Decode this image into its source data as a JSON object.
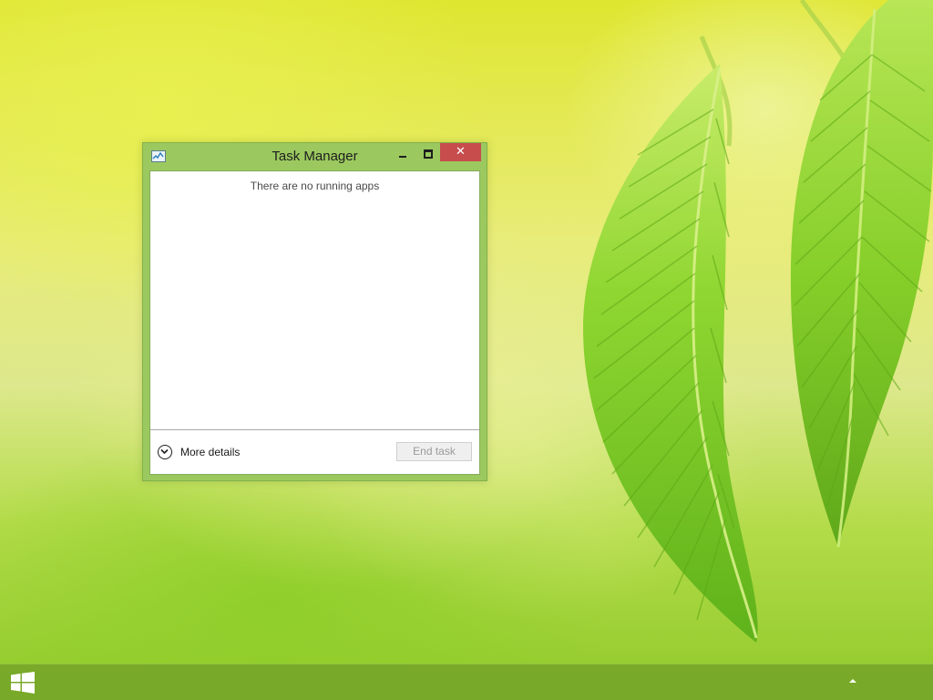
{
  "desktop": {
    "wallpaper": "green-leaves",
    "colors": {
      "background_top": "#dfe62f",
      "background_bottom": "#90c92a",
      "leaf": "#7ccb1e"
    }
  },
  "window": {
    "title": "Task Manager",
    "icon": "task-manager-icon",
    "controls": {
      "minimize": "minimize-icon",
      "maximize": "maximize-icon",
      "close": "✕"
    },
    "colors": {
      "frame": "#9bc95f",
      "close_button": "#c74d4d"
    },
    "content": {
      "empty_message": "There are no running apps"
    },
    "footer": {
      "more_details_icon": "chevron-down-circle-icon",
      "more_details_label": "More details",
      "end_task_label": "End task",
      "end_task_enabled": false
    }
  },
  "taskbar": {
    "start_icon": "windows-logo-icon",
    "tray_icon": "show-hidden-icons-arrow",
    "color": "#76a628"
  }
}
